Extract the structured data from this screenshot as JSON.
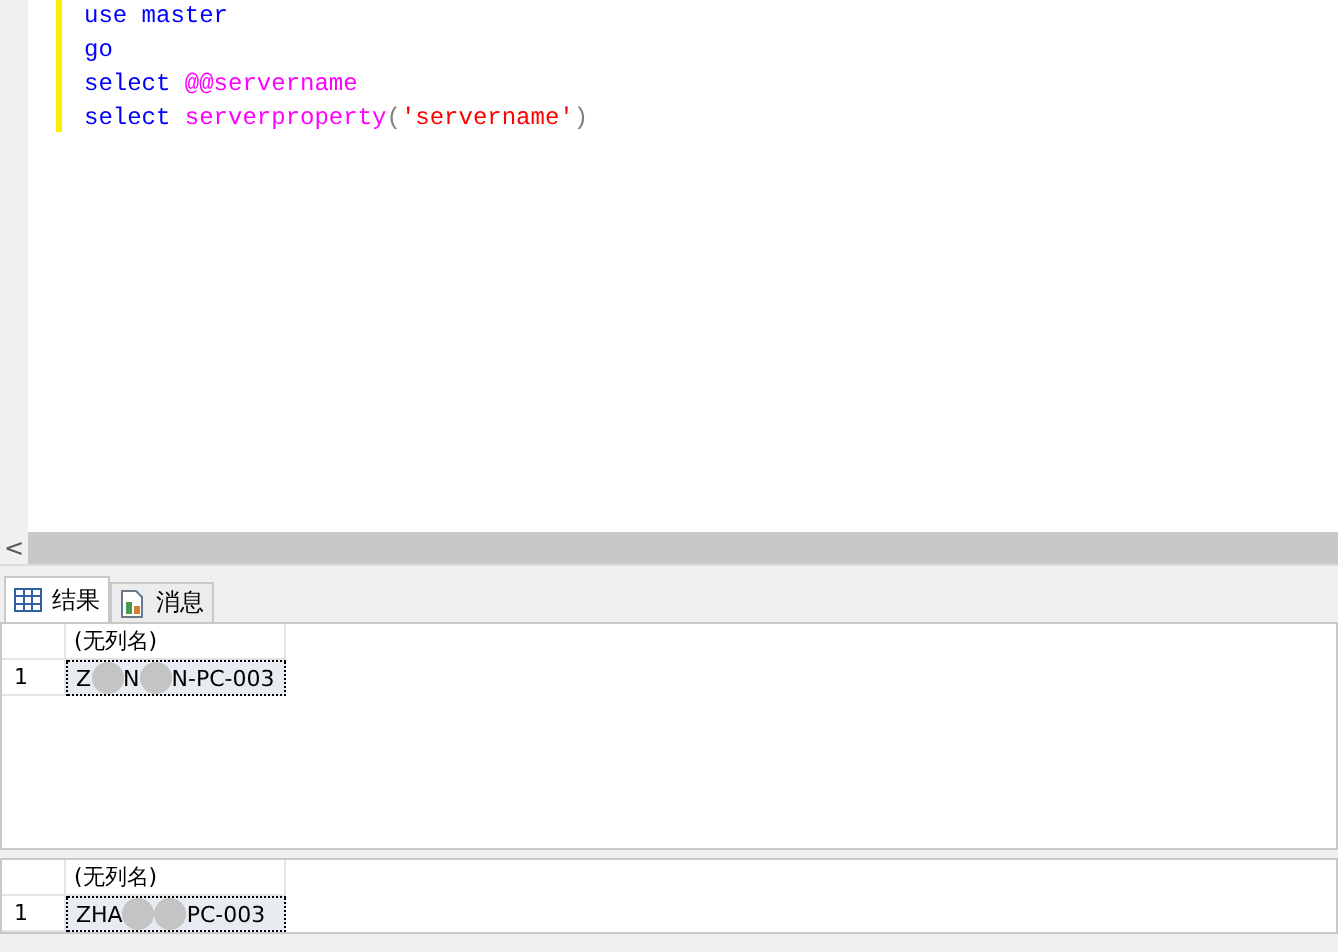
{
  "editor": {
    "lines": [
      [
        {
          "kind": "keyword",
          "text": "use"
        },
        {
          "kind": "keyword",
          "text": "master"
        }
      ],
      [
        {
          "kind": "keyword",
          "text": "go"
        }
      ],
      [
        {
          "kind": "keyword",
          "text": "select"
        },
        {
          "kind": "function",
          "text": "@@servername"
        }
      ],
      [
        {
          "kind": "keyword",
          "text": "select"
        },
        {
          "kind": "function",
          "text": "serverproperty"
        },
        {
          "kind": "operator",
          "text": "("
        },
        {
          "kind": "string",
          "text": "'servername'"
        },
        {
          "kind": "operator",
          "text": ")"
        }
      ]
    ]
  },
  "scroll_arrow": "<",
  "tabs": [
    {
      "label": "结果",
      "kind": "grid",
      "selected": true
    },
    {
      "label": "消息",
      "kind": "document",
      "selected": false
    }
  ],
  "result_sets": [
    {
      "column": "(无列名)",
      "rows": [
        {
          "number": "1",
          "segments": [
            {
              "kind": "text",
              "text": "Z"
            },
            {
              "kind": "blot"
            },
            {
              "kind": "text",
              "text": "N"
            },
            {
              "kind": "blot"
            },
            {
              "kind": "text",
              "text": "N-PC-003"
            }
          ]
        }
      ]
    },
    {
      "column": "(无列名)",
      "rows": [
        {
          "number": "1",
          "segments": [
            {
              "kind": "text",
              "text": "ZHA"
            },
            {
              "kind": "blot"
            },
            {
              "kind": "blot"
            },
            {
              "kind": "text",
              "text": "PC-003"
            }
          ]
        }
      ]
    }
  ]
}
